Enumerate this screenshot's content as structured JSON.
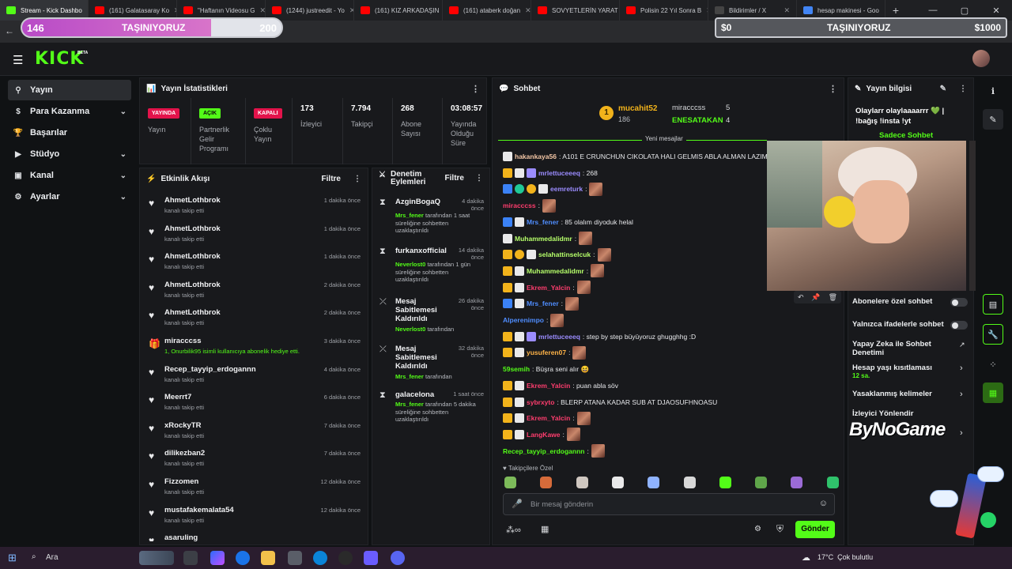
{
  "browser": {
    "tabs": [
      {
        "title": "Stream - Kick Dashbo",
        "color": "#53fc18",
        "active": true
      },
      {
        "title": "(161) Galatasaray Ko",
        "color": "#ff0000",
        "active": false
      },
      {
        "title": "\"Haftanın Videosu G",
        "color": "#ff0000",
        "active": false
      },
      {
        "title": "(1244) justreedit - Yo",
        "color": "#ff0000",
        "active": false
      },
      {
        "title": "(161) KIZ ARKADAŞIN",
        "color": "#ff0000",
        "active": false
      },
      {
        "title": "(161) ataberk doğan",
        "color": "#ff0000",
        "active": false
      },
      {
        "title": "SOVYETLERİN YARAT",
        "color": "#ff0000",
        "active": false
      },
      {
        "title": "Polisin 22 Yıl Sonra B",
        "color": "#ff0000",
        "active": false
      },
      {
        "title": "Bildirimler / X",
        "color": "#444444",
        "active": false
      },
      {
        "title": "hesap makinesi - Goo",
        "color": "#4285f4",
        "active": false
      }
    ]
  },
  "overlay": {
    "left_goal": {
      "current": "146",
      "label": "TAŞINIYORUZ",
      "target": "200",
      "progress": 0.73
    },
    "right_goal": {
      "current": "$0",
      "label": "TAŞINIYORUZ",
      "target": "$1000",
      "progress": 0.0
    },
    "watermark": "ByNoGame"
  },
  "header": {
    "logo": "KICK",
    "logo_badge": "BETA"
  },
  "sidebar": {
    "items": [
      {
        "label": "Yayın",
        "icon": "broadcast-icon",
        "expandable": false,
        "active": true
      },
      {
        "label": "Para Kazanma",
        "icon": "money-icon",
        "expandable": true,
        "active": false
      },
      {
        "label": "Başarılar",
        "icon": "trophy-icon",
        "expandable": false,
        "active": false
      },
      {
        "label": "Stüdyo",
        "icon": "studio-icon",
        "expandable": true,
        "active": false
      },
      {
        "label": "Kanal",
        "icon": "channel-icon",
        "expandable": true,
        "active": false
      },
      {
        "label": "Ayarlar",
        "icon": "gear-icon",
        "expandable": true,
        "active": false
      }
    ]
  },
  "stats": {
    "title": "Yayın İstatistikleri",
    "cells": [
      {
        "badge": "YAYINDA",
        "badge_color": "#e3134b",
        "label": "Yayın"
      },
      {
        "badge": "AÇIK",
        "badge_color": "#53fc18",
        "label": "Partnerlik Gelir Programı"
      },
      {
        "badge": "KAPALI",
        "badge_color": "#e3134b",
        "label": "Çoklu Yayın"
      },
      {
        "value": "173",
        "label": "İzleyici"
      },
      {
        "value": "7.794",
        "label": "Takipçi"
      },
      {
        "value": "268",
        "label": "Abone Sayısı"
      },
      {
        "value": "03:08:57",
        "label": "Yayında Olduğu Süre"
      }
    ]
  },
  "activity": {
    "title": "Etkinlik Akışı",
    "filter": "Filtre",
    "items": [
      {
        "name": "AhmetLothbrok",
        "desc": "kanalı takip etti",
        "time": "1 dakika önce",
        "type": "follow"
      },
      {
        "name": "AhmetLothbrok",
        "desc": "kanalı takip etti",
        "time": "1 dakika önce",
        "type": "follow"
      },
      {
        "name": "AhmetLothbrok",
        "desc": "kanalı takip etti",
        "time": "1 dakika önce",
        "type": "follow"
      },
      {
        "name": "AhmetLothbrok",
        "desc": "kanalı takip etti",
        "time": "2 dakika önce",
        "type": "follow"
      },
      {
        "name": "AhmetLothbrok",
        "desc": "kanalı takip etti",
        "time": "2 dakika önce",
        "type": "follow"
      },
      {
        "name": "miracccss",
        "desc": "1, Onurbilik95 isimli kullanıcıya abonelik hediye etti.",
        "time": "3 dakika önce",
        "type": "gift"
      },
      {
        "name": "Recep_tayyip_erdogannn",
        "desc": "kanalı takip etti",
        "time": "4 dakika önce",
        "type": "follow"
      },
      {
        "name": "Meerrt7",
        "desc": "kanalı takip etti",
        "time": "6 dakika önce",
        "type": "follow"
      },
      {
        "name": "xRockyTR",
        "desc": "kanalı takip etti",
        "time": "7 dakika önce",
        "type": "follow"
      },
      {
        "name": "dilikezban2",
        "desc": "kanalı takip etti",
        "time": "7 dakika önce",
        "type": "follow"
      },
      {
        "name": "Fizzomen",
        "desc": "kanalı takip etti",
        "time": "12 dakika önce",
        "type": "follow"
      },
      {
        "name": "mustafakemalata54",
        "desc": "kanalı takip etti",
        "time": "12 dakika önce",
        "type": "follow"
      },
      {
        "name": "asaruling",
        "desc": "",
        "time": "",
        "type": "follow"
      }
    ]
  },
  "moderation": {
    "title": "Denetim Eylemleri",
    "filter": "Filtre",
    "items": [
      {
        "name": "AzginBogaQ",
        "time": "4 dakika önce",
        "by": "Mrs_fener",
        "rest": "tarafından 1 saat süreliğine sohbetten uzaklaştırıldı",
        "icon": "hourglass-icon"
      },
      {
        "name": "furkanxofficial",
        "time": "14 dakika önce",
        "by": "Neverlost0",
        "rest": "tarafından 1 gün süreliğine sohbetten uzaklaştırıldı",
        "icon": "hourglass-icon"
      },
      {
        "name": "Mesaj Sabitlemesi Kaldırıldı",
        "time": "26 dakika önce",
        "by": "Neverlost0",
        "rest": "tarafından",
        "icon": "unpin-icon"
      },
      {
        "name": "Mesaj Sabitlemesi Kaldırıldı",
        "time": "32 dakika önce",
        "by": "Mrs_fener",
        "rest": "tarafından",
        "icon": "unpin-icon"
      },
      {
        "name": "galacelona",
        "time": "1 saat önce",
        "by": "Mrs_fener",
        "rest": "tarafından 5 dakika süreliğine sohbetten uzaklaştırıldı",
        "icon": "hourglass-icon"
      }
    ]
  },
  "chat": {
    "title": "Sohbet",
    "top_gifters": [
      {
        "name": "mucahit52",
        "count": "186",
        "rank": "1"
      },
      {
        "name": "miracccss",
        "count": "5"
      },
      {
        "name": "ENESATAKAN",
        "count": "4"
      }
    ],
    "new_messages": "Yeni mesajlar",
    "messages": [
      {
        "user": "hakankaya56",
        "color": "#f3c6a5",
        "text": ": A101 E CRUNCHUN CIKOLATA HALI GELMIS ABLA ALMAN LAZIM"
      },
      {
        "user": "mrlettuceeeq",
        "color": "#9b8cff",
        "text": ": 268"
      },
      {
        "user": "eemreturk",
        "color": "#9b8cff",
        "text": ":"
      },
      {
        "user": "miracccss",
        "color": "#ff3d6e",
        "text": ":"
      },
      {
        "user": "Mrs_fener",
        "color": "#4f8dff",
        "text": ": 85 olalım diyoduk helal"
      },
      {
        "user": "Muhammedalidmr",
        "color": "#b6ff6a",
        "text": ":"
      },
      {
        "user": "selahattinselcuk",
        "color": "#b6ff6a",
        "text": ":"
      },
      {
        "user": "Muhammedalidmr",
        "color": "#b6ff6a",
        "text": ":"
      },
      {
        "user": "Ekrem_Yalcin",
        "color": "#ff3d6e",
        "text": ":"
      },
      {
        "user": "Mrs_fener",
        "color": "#4f8dff",
        "text": ":"
      },
      {
        "user": "Alperenimpo",
        "color": "#4f8dff",
        "text": ":"
      },
      {
        "user": "mrlettuceeeq",
        "color": "#9b8cff",
        "text": ": step by step büyüyoruz ghugghhg :D"
      },
      {
        "user": "yusuferen07",
        "color": "#ffb347",
        "text": ":"
      },
      {
        "user": "59semih",
        "color": "#53fc18",
        "text": ": Büşra seni alır 😆"
      },
      {
        "user": "Ekrem_Yalcin",
        "color": "#ff3d6e",
        "text": ": puan abla söv"
      },
      {
        "user": "sybrxyto",
        "color": "#ff3d6e",
        "text": ": BLERP ATANA KADAR SUB AT DJAOSUFHNOASU"
      },
      {
        "user": "Ekrem_Yalcin",
        "color": "#ff3d6e",
        "text": ":"
      },
      {
        "user": "LangKawe",
        "color": "#ff3d6e",
        "text": ":"
      },
      {
        "user": "Recep_tayyip_erdogannn",
        "color": "#53fc18",
        "text": ":"
      }
    ],
    "emote_section": "Takipçilere Özel",
    "input_placeholder": "Bir mesaj gönderin",
    "send_label": "Gönder"
  },
  "stream_info": {
    "title": "Yayın bilgisi",
    "stream_title": "Olaylarr olaylaaaarrr 💚 | !bağış !insta !yt",
    "chat_label": "Sadece Sohbet",
    "settings": [
      {
        "label": "Abonelere özel sohbet",
        "type": "toggle"
      },
      {
        "label": "Yalnızca ifadelerle sohbet",
        "type": "toggle"
      },
      {
        "label": "Yapay Zeka ile Sohbet Denetimi",
        "type": "external"
      },
      {
        "label": "Hesap yaşı kısıtlaması",
        "sub": "12 sa.",
        "type": "chevron"
      },
      {
        "label": "Yasaklanmış kelimeler",
        "type": "chevron"
      },
      {
        "label": "İzleyici Yönlendir",
        "type": "chevron"
      }
    ]
  },
  "taskbar": {
    "search": "Ara",
    "weather": "17°C  Çok bulutlu"
  },
  "colors": {
    "kick_green": "#53fc18",
    "live_red": "#e3134b",
    "panel_bg": "#18191c"
  }
}
